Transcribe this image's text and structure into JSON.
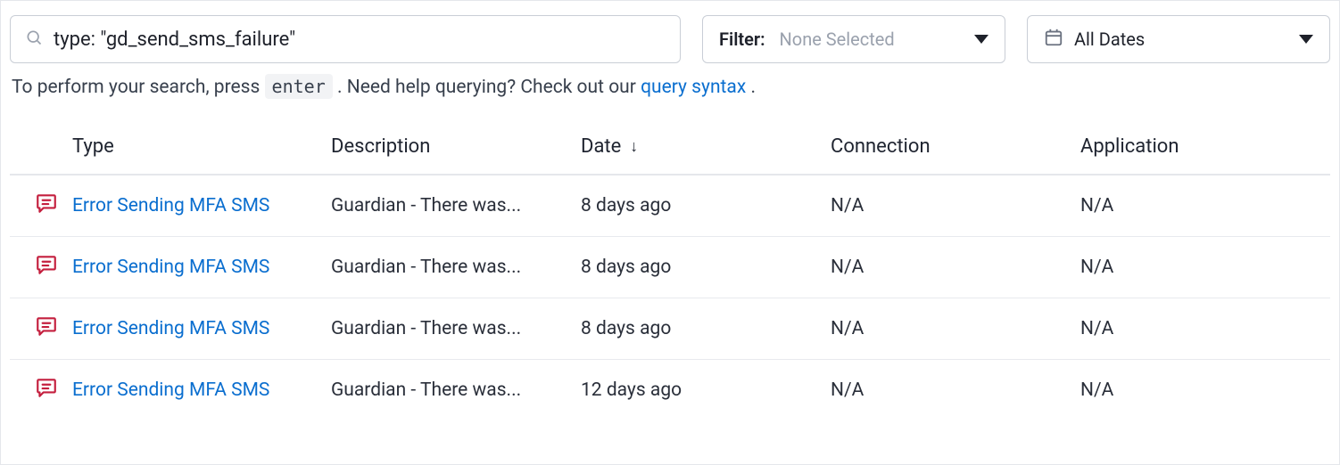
{
  "search": {
    "value": "type: \"gd_send_sms_failure\""
  },
  "filter": {
    "label": "Filter:",
    "value": "None Selected"
  },
  "date_filter": {
    "value": "All Dates"
  },
  "helper": {
    "prefix": "To perform your search, press ",
    "key": "enter",
    "mid": ". Need help querying? Check out our ",
    "link": "query syntax",
    "suffix": "."
  },
  "table": {
    "headers": {
      "type": "Type",
      "description": "Description",
      "date": "Date",
      "connection": "Connection",
      "application": "Application"
    },
    "rows": [
      {
        "type": "Error Sending MFA SMS",
        "description": "Guardian - There was...",
        "date": "8 days ago",
        "connection": "N/A",
        "application": "N/A"
      },
      {
        "type": "Error Sending MFA SMS",
        "description": "Guardian - There was...",
        "date": "8 days ago",
        "connection": "N/A",
        "application": "N/A"
      },
      {
        "type": "Error Sending MFA SMS",
        "description": "Guardian - There was...",
        "date": "8 days ago",
        "connection": "N/A",
        "application": "N/A"
      },
      {
        "type": "Error Sending MFA SMS",
        "description": "Guardian - There was...",
        "date": "12 days ago",
        "connection": "N/A",
        "application": "N/A"
      }
    ]
  }
}
